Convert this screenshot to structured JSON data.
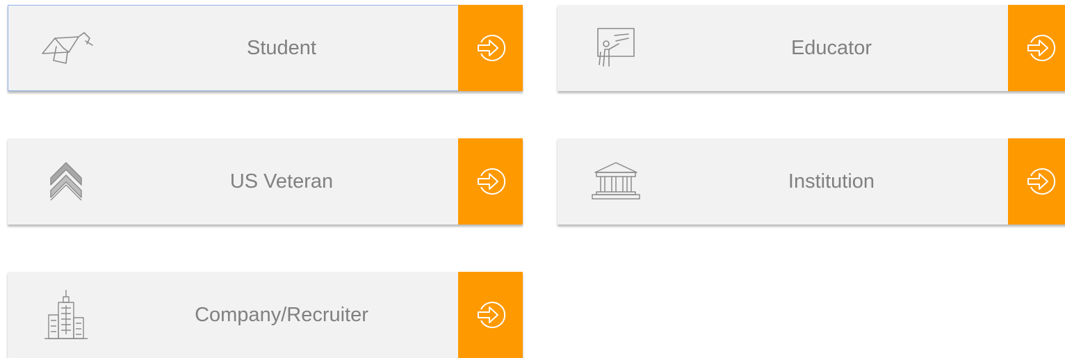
{
  "accent_color": "#ff9900",
  "cards": [
    {
      "label": "Student",
      "icon": "graduation-cap-icon",
      "selected": true
    },
    {
      "label": "Educator",
      "icon": "teacher-presentation-icon",
      "selected": false
    },
    {
      "label": "US Veteran",
      "icon": "military-rank-chevron-icon",
      "selected": false
    },
    {
      "label": "Institution",
      "icon": "institution-building-icon",
      "selected": false
    },
    {
      "label": "Company/Recruiter",
      "icon": "office-skyscraper-icon",
      "selected": false
    }
  ],
  "go_icon": "arrow-enter-circle-icon"
}
